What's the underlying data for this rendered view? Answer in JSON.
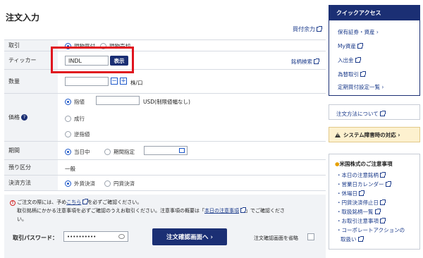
{
  "page_title": "注文入力",
  "buying_power_link": "買付余力",
  "form": {
    "trade": {
      "label": "取引",
      "opt1": "現物買付",
      "opt2": "現物売却"
    },
    "ticker": {
      "label": "ティッカー",
      "value": "INDL",
      "show_button": "表示",
      "search_link": "銘柄検索"
    },
    "quantity": {
      "label": "数量",
      "unit": "株/口",
      "minus": "−",
      "plus": "+"
    },
    "price": {
      "label": "価格",
      "limit": "指値",
      "limit_note": "USD(制限値幅なし)",
      "market": "成行",
      "stop": "逆指値"
    },
    "term": {
      "label": "期間",
      "today": "当日中",
      "specify": "期間指定"
    },
    "custody": {
      "label": "預り区分",
      "value": "一般"
    },
    "settlement": {
      "label": "決済方法",
      "foreign": "外貨決済",
      "yen": "円貨決済"
    }
  },
  "notice": {
    "line1_a": "ご注文の際には、予め",
    "line1_link": "こちら",
    "line1_b": "を必ずご確認ください。",
    "line2_a": "取引銘柄にかかる注意事項を必ずご確認のうえお取引ください。注意事項の概要は「",
    "line2_link": "本日の注意事項",
    "line2_b": "」でご確認くださ",
    "line3": "い。"
  },
  "password": {
    "label": "取引パスワード：",
    "value": "••••••••••"
  },
  "confirm_button": "注文確認画面へ ›",
  "skip_confirm": "注文確認画面を省略",
  "sidebar": {
    "quick_access": {
      "title": "クイックアクセス",
      "items": [
        "保有証券・資産 ›",
        "My資産",
        "入出金",
        "為替取引",
        "定期買付設定一覧 ›"
      ]
    },
    "order_method": "注文方法について",
    "system_alert": "システム障害時の対応 ›",
    "caution": {
      "title": "米国株式のご注意事項",
      "items": [
        "・本日の注意銘柄",
        "・営業日カレンダー",
        "・休場日",
        "・円貨決済停止日",
        "・取扱銘柄一覧",
        "・お取引注意事項",
        "・コーポレートアクションの",
        "取扱い"
      ]
    }
  },
  "colors": {
    "navy": "#1b2f74",
    "link": "#1a3a8a",
    "highlight": "#e0141e",
    "label_bg": "#f1f3f6",
    "alert_bg": "#fdf1cf"
  }
}
